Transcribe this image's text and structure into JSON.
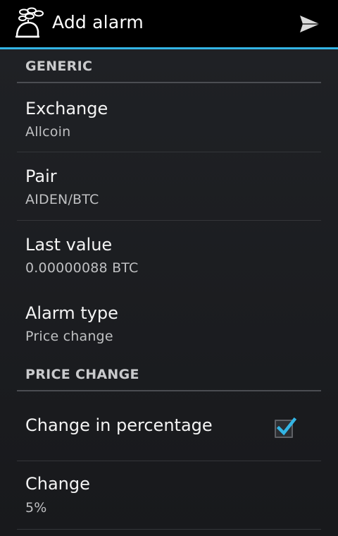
{
  "actionbar": {
    "title": "Add alarm",
    "app_icon": "alarm-clock-coins-icon",
    "send_icon": "send-icon",
    "accent_color": "#33b5e5"
  },
  "sections": {
    "generic": {
      "header": "GENERIC",
      "exchange": {
        "title": "Exchange",
        "summary": "Allcoin"
      },
      "pair": {
        "title": "Pair",
        "summary": "AIDEN/BTC"
      },
      "last_value": {
        "title": "Last value",
        "summary": "0.00000088 BTC"
      },
      "alarm_type": {
        "title": "Alarm type",
        "summary": "Price change"
      }
    },
    "price_change": {
      "header": "PRICE CHANGE",
      "change_in_percentage": {
        "title": "Change in percentage",
        "checked": true
      },
      "change": {
        "title": "Change",
        "summary": "5%"
      }
    }
  }
}
